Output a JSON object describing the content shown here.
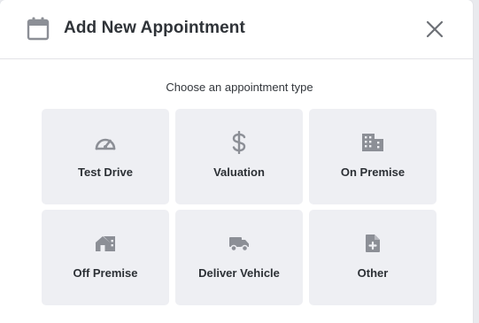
{
  "dialog": {
    "title": "Add New Appointment",
    "header_icon": "calendar-icon",
    "close_icon": "close-icon"
  },
  "prompt": "Choose an appointment type",
  "types": [
    {
      "label": "Test Drive",
      "icon": "speedometer-icon"
    },
    {
      "label": "Valuation",
      "icon": "dollar-icon"
    },
    {
      "label": "On Premise",
      "icon": "building-icon"
    },
    {
      "label": "Off Premise",
      "icon": "house-icon"
    },
    {
      "label": "Deliver Vehicle",
      "icon": "truck-icon"
    },
    {
      "label": "Other",
      "icon": "file-plus-icon"
    }
  ],
  "colors": {
    "icon": "#8c8f96",
    "card": "#eeeff3",
    "text": "#2c3035"
  }
}
